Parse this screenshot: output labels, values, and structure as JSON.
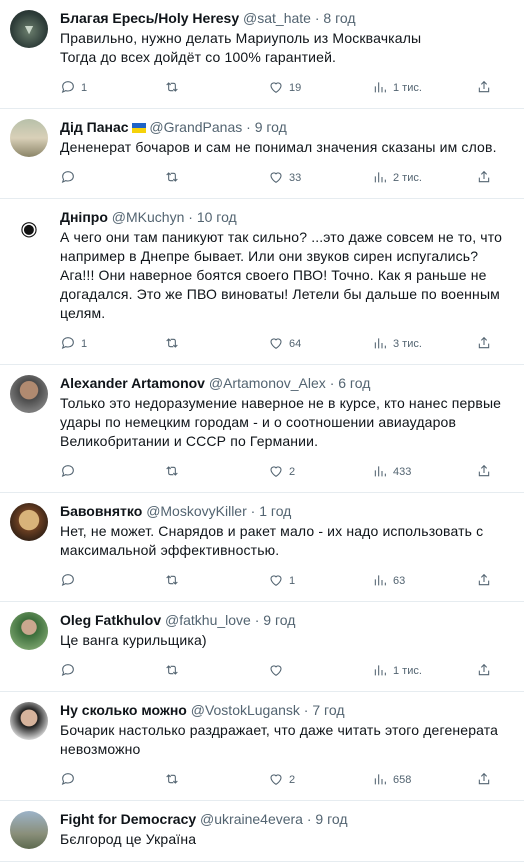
{
  "tweets": [
    {
      "name": "Благая Ересь/Holy Heresy",
      "handle": "@sat_hate",
      "time": "8 год",
      "flag": false,
      "text": [
        "Правильно, нужно делать Мариуполь из Москвачкалы",
        "Тогда до всех дойдёт со 100% гарантией."
      ],
      "replies": "1",
      "retweets": "",
      "likes": "19",
      "views": "1 тис.",
      "avatar": "eagle"
    },
    {
      "name": "Дід Панас",
      "handle": "@GrandPanas",
      "time": "9 год",
      "flag": true,
      "text": [
        "Дененерат бочаров и сам не понимал значения сказаны им слов."
      ],
      "replies": "",
      "retweets": "",
      "likes": "33",
      "views": "2 тис.",
      "avatar": "oldman"
    },
    {
      "name": "Дніпро",
      "handle": "@MKuchyn",
      "time": "10 год",
      "flag": false,
      "text": [
        "А чего они там паникуют так сильно? ...это даже совсем не то, что",
        "например в Днепре бывает. Или они звуков сирен испугались?",
        "Ага!!! Они наверное боятся своего ПВО! Точно. Как я раньше не",
        "догадался. Это же ПВО виноваты! Летели бы дальше по военным",
        "целям."
      ],
      "replies": "1",
      "retweets": "",
      "likes": "64",
      "views": "3 тис.",
      "avatar": "eye"
    },
    {
      "name": "Alexander Artamonov",
      "handle": "@Artamonov_Alex",
      "time": "6 год",
      "flag": false,
      "text": [
        "Только это недоразумение наверное не в курсе, кто нанес первые",
        "удары по немецким городам - и о соотношении авиаударов",
        "Великобритании и СССР по Германии."
      ],
      "replies": "",
      "retweets": "",
      "likes": "2",
      "views": "433",
      "avatar": "man"
    },
    {
      "name": "Бавовнятко",
      "handle": "@MoskovyKiller",
      "time": "1 год",
      "flag": false,
      "text": [
        "Нет, не может. Снарядов и ракет мало - их надо использовать с",
        "максимальной эффективностью."
      ],
      "replies": "",
      "retweets": "",
      "likes": "1",
      "views": "63",
      "avatar": "toy"
    },
    {
      "name": "Oleg Fatkhulov",
      "handle": "@fatkhu_love",
      "time": "9 год",
      "flag": false,
      "text": [
        "Це ванга курильщика)"
      ],
      "replies": "",
      "retweets": "",
      "likes": "",
      "views": "1 тис.",
      "avatar": "green"
    },
    {
      "name": "Ну сколько можно",
      "handle": "@VostokLugansk",
      "time": "7 год",
      "flag": false,
      "text": [
        "Бочарик настолько раздражает, что даже читать этого дегенерата",
        "невозможно"
      ],
      "replies": "",
      "retweets": "",
      "likes": "2",
      "views": "658",
      "avatar": "woman"
    },
    {
      "name": "Fight for Democracy",
      "handle": "@ukraine4evera",
      "time": "9 год",
      "flag": false,
      "text": [
        "Бєлгород це Україна"
      ],
      "replies": null,
      "retweets": null,
      "likes": null,
      "views": null,
      "avatar": "statue"
    }
  ]
}
